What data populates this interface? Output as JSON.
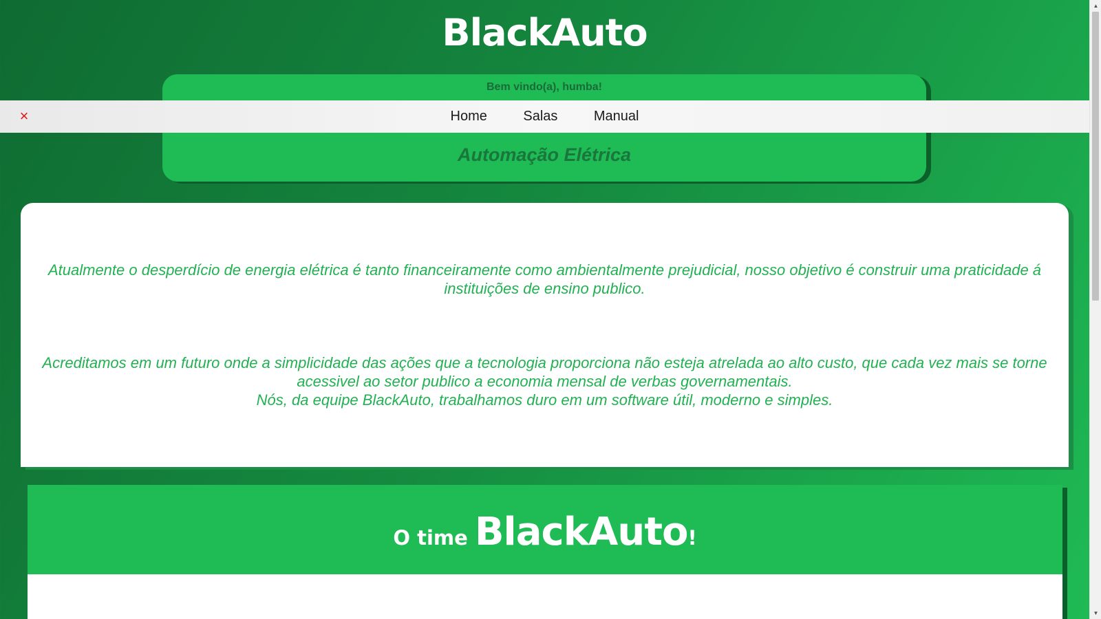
{
  "header": {
    "brand": "BlackAuto",
    "welcome": "Bem vindo(a), humba!",
    "subtitle": "Automação Elétrica"
  },
  "nav": {
    "close_icon": "×",
    "items": [
      {
        "label": "Home"
      },
      {
        "label": "Salas"
      },
      {
        "label": "Manual"
      }
    ]
  },
  "content": {
    "paragraph1": "Atualmente o desperdício de energia elétrica é tanto financeiramente como ambientalmente prejudicial, nosso objetivo é construir uma praticidade á instituições de ensino publico.",
    "paragraph2": "Acreditamos em um futuro onde a simplicidade das ações que a tecnologia proporciona não esteja atrelada ao alto custo, que cada vez mais se torne acessivel ao setor publico a economia mensal de verbas governamentais.",
    "paragraph3": "Nós, da equipe BlackAuto, trabalhamos duro em um software útil, moderno e simples."
  },
  "team": {
    "title_prefix": "O time ",
    "title_brand": "BlackAuto",
    "title_suffix": "!"
  },
  "scrollbar": {
    "up_icon": "▲",
    "down_icon": "▼"
  },
  "colors": {
    "accent_green": "#1fbb55",
    "dark_green": "#0f6b32",
    "text_green": "#22b152",
    "close_red": "#e01818"
  }
}
